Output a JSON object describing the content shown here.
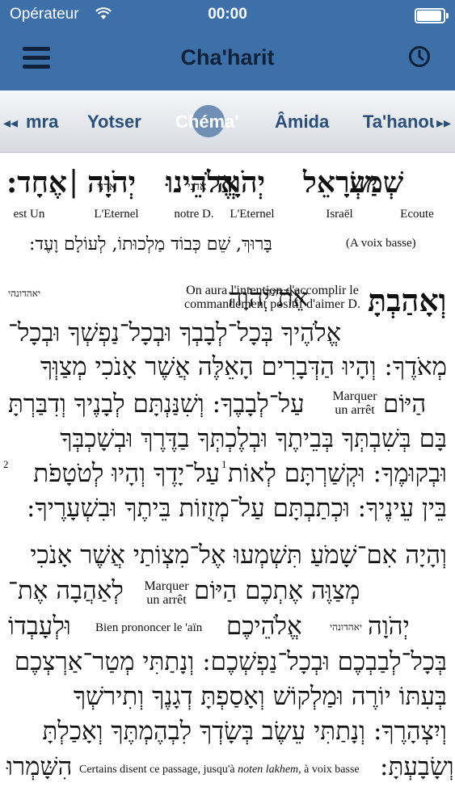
{
  "status_bar": {
    "carrier": "Opérateur",
    "time": "00:00",
    "battery_percent": 100
  },
  "navbar": {
    "title": "Cha'harit",
    "menu_icon": "hamburger-icon",
    "history_icon": "clock-icon"
  },
  "tabs": {
    "items": [
      "mra",
      "Yotser",
      "Chéma'",
      "Âmida",
      "Ta'hanoun"
    ],
    "selected": "Chéma'",
    "left_arrow": "◂◂",
    "right_arrow": "▸▸"
  },
  "shema_header": {
    "words": [
      "שְׁמַע",
      "יִשְׂרָאֵל",
      "יְהֹוָה",
      "אֱלֹהֵינוּ",
      "יְהֹוָה",
      "אֶחָד:"
    ],
    "divine_name_small": "אדני",
    "separator": "|",
    "translations": [
      "Ecoute",
      "Israël",
      "L'Eternel",
      "notre D.",
      "L'Eternel",
      "est Un"
    ]
  },
  "baruch_line": {
    "hebrew": "בָּרוּךְ, שֵׁם כְּבוֹד מַלְכוּתוֹ, לְעוֹלָם וָעֶד:",
    "note": "(A voix basse)"
  },
  "veahavta": {
    "first_word": "וְאָהַבְתָּ",
    "rest_first": "אֵת יְהֹוָה",
    "small_name": "יאהדונהי",
    "note": "On aura l'intention d'accomplir le commandement positif d'aimer D.",
    "lines": [
      "אֱלֹהֶיךָ בְּכָל־לְבָבְךָ וּבְכָל־נַפְשְׁךָ וּבְכָל־",
      "מְאֹדֶךָ: וְהָיוּ הַדְּבָרִים הָאֵלֶּה אֲשֶׁר אָנֹכִי מְצַוְּךָ",
      "עַל־לְבָבֶךָ: וְשִׁנַּנְתָּם לְבָנֶיךָ וְדִבַּרְתָּ",
      "בָּם בְּשִׁבְתְּךָ בְּבֵיתֶךָ וּבְלֶכְתְּךָ בַדֶּרֶךְ וּבְשָׁכְבְּךָ",
      "וּבְקוּמֶךָ: וּקְשַׁרְתָּם לְאוֹת עַל־יָדֶךָ וְהָיוּ לְטֹטָפֹת",
      "בֵּין עֵינֶיךָ: וּכְתַבְתָּם עַל־מְזֻזוֹת בֵּיתֶךָ וּבִשְׁעָרֶיךָ:"
    ],
    "hayom": "הַיּוֹם",
    "stop_note": "Marquer un arrêt",
    "footnote_1": "1",
    "footnote_2": "2"
  },
  "vehaya": {
    "lines": [
      "וְהָיָה אִם־שָׁמֹעַ תִּשְׁמְעוּ אֶל־מִצְוֹתַי אֲשֶׁר אָנֹכִי",
      "מְצַוֶּה אֶתְכֶם הַיּוֹם",
      "לְאַהֲבָה אֶת־",
      "יְהֹוָה",
      "אֱלֹהֵיכֶם",
      "וּלְעָבְדוֹ",
      "בְּכָל־לְבַבְכֶם וּבְכָל־נַפְשְׁכֶם: וְנָתַתִּי מְטַר־אַרְצְכֶם",
      "בְּעִתּוֹ יוֹרֶה וּמַלְקוֹשׁ וְאָסַפְתָּ דְגָנֶךָ וְתִירשְׁךָ",
      "וְיִצְהָרֶךָ: וְנָתַתִּי עֵשֶׂב בְּשָׂדְךָ לִבְהֶמְתֶּךָ וְאָכַלְתָּ",
      "וְשָׂבָעְתָּ:",
      "הִשָּׁמְרוּ"
    ],
    "stop_note": "Marquer un arrêt",
    "small_name": "יאהדונהי",
    "ain_note": "Bien prononcer le 'aïn",
    "last_note_pre": "Certains disent ce passage, jusqu'à ",
    "last_note_em": "noten lakhem",
    "last_note_post": ", à voix basse"
  }
}
